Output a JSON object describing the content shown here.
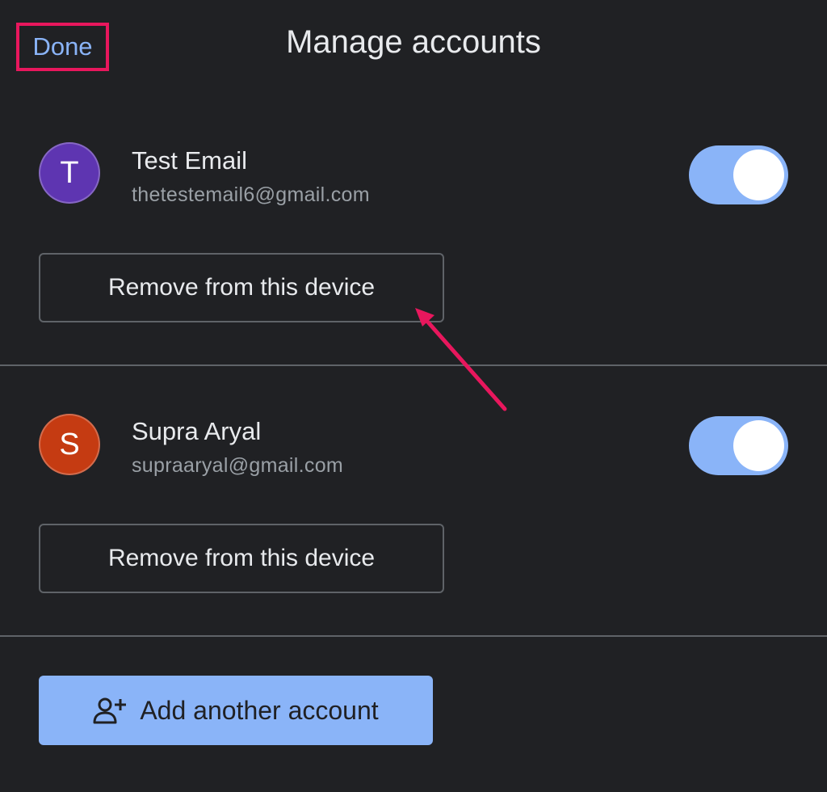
{
  "header": {
    "done_label": "Done",
    "title": "Manage accounts"
  },
  "accounts": [
    {
      "initial": "T",
      "name": "Test Email",
      "email": "thetestemail6@gmail.com",
      "avatar_color": "#5e35b1",
      "toggle_on": true,
      "remove_label": "Remove from this device"
    },
    {
      "initial": "S",
      "name": "Supra Aryal",
      "email": "supraaryal@gmail.com",
      "avatar_color": "#c53b12",
      "toggle_on": true,
      "remove_label": "Remove from this device"
    }
  ],
  "add_account": {
    "label": "Add another account",
    "icon": "add-person-icon"
  },
  "colors": {
    "background": "#202124",
    "accent": "#8ab4f8",
    "highlight": "#e8175d",
    "divider": "#5f6368"
  }
}
